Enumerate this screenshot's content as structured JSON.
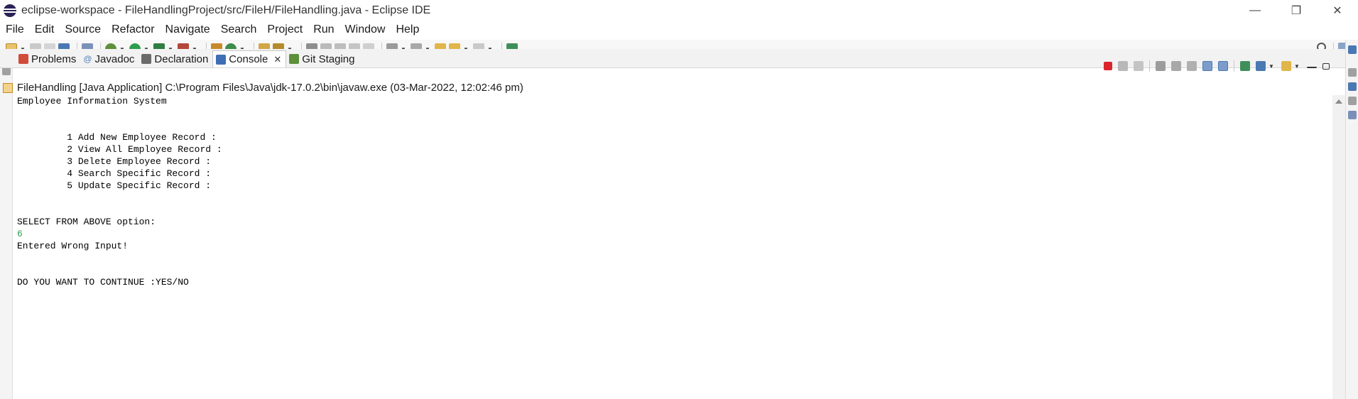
{
  "window": {
    "title": "eclipse-workspace - FileHandlingProject/src/FileH/FileHandling.java - Eclipse IDE"
  },
  "menu": {
    "items": [
      "File",
      "Edit",
      "Source",
      "Refactor",
      "Navigate",
      "Search",
      "Project",
      "Run",
      "Window",
      "Help"
    ]
  },
  "tabs": [
    {
      "label": "Problems",
      "icon": "problems-icon",
      "color": "#d14b3b"
    },
    {
      "label": "Javadoc",
      "icon": "javadoc-icon",
      "color": "#4e7fb8"
    },
    {
      "label": "Declaration",
      "icon": "declaration-icon",
      "color": "#6a6a6a"
    },
    {
      "label": "Console",
      "icon": "console-icon",
      "color": "#3e6fb5",
      "active": true
    },
    {
      "label": "Git Staging",
      "icon": "git-staging-icon",
      "color": "#5d8f3a"
    }
  ],
  "launch": {
    "info": "FileHandling [Java Application] C:\\Program Files\\Java\\jdk-17.0.2\\bin\\javaw.exe  (03-Mar-2022, 12:02:46 pm)"
  },
  "console": {
    "lines": [
      {
        "text": "Employee Information System",
        "type": "output"
      },
      {
        "text": "",
        "type": "output"
      },
      {
        "text": "",
        "type": "output"
      },
      {
        "text": "         1 Add New Employee Record :",
        "type": "output"
      },
      {
        "text": "         2 View All Employee Record :",
        "type": "output"
      },
      {
        "text": "         3 Delete Employee Record :",
        "type": "output"
      },
      {
        "text": "         4 Search Specific Record :",
        "type": "output"
      },
      {
        "text": "         5 Update Specific Record :",
        "type": "output"
      },
      {
        "text": "",
        "type": "output"
      },
      {
        "text": "",
        "type": "output"
      },
      {
        "text": "SELECT FROM ABOVE option:",
        "type": "output"
      },
      {
        "text": "6",
        "type": "input"
      },
      {
        "text": "Entered Wrong Input!",
        "type": "output"
      },
      {
        "text": "",
        "type": "output"
      },
      {
        "text": "",
        "type": "output"
      },
      {
        "text": "DO YOU WANT TO CONTINUE :YES/NO",
        "type": "output"
      }
    ]
  },
  "colors": {
    "console_input": "#2e9e4e",
    "terminate_button": "#d9262c"
  }
}
